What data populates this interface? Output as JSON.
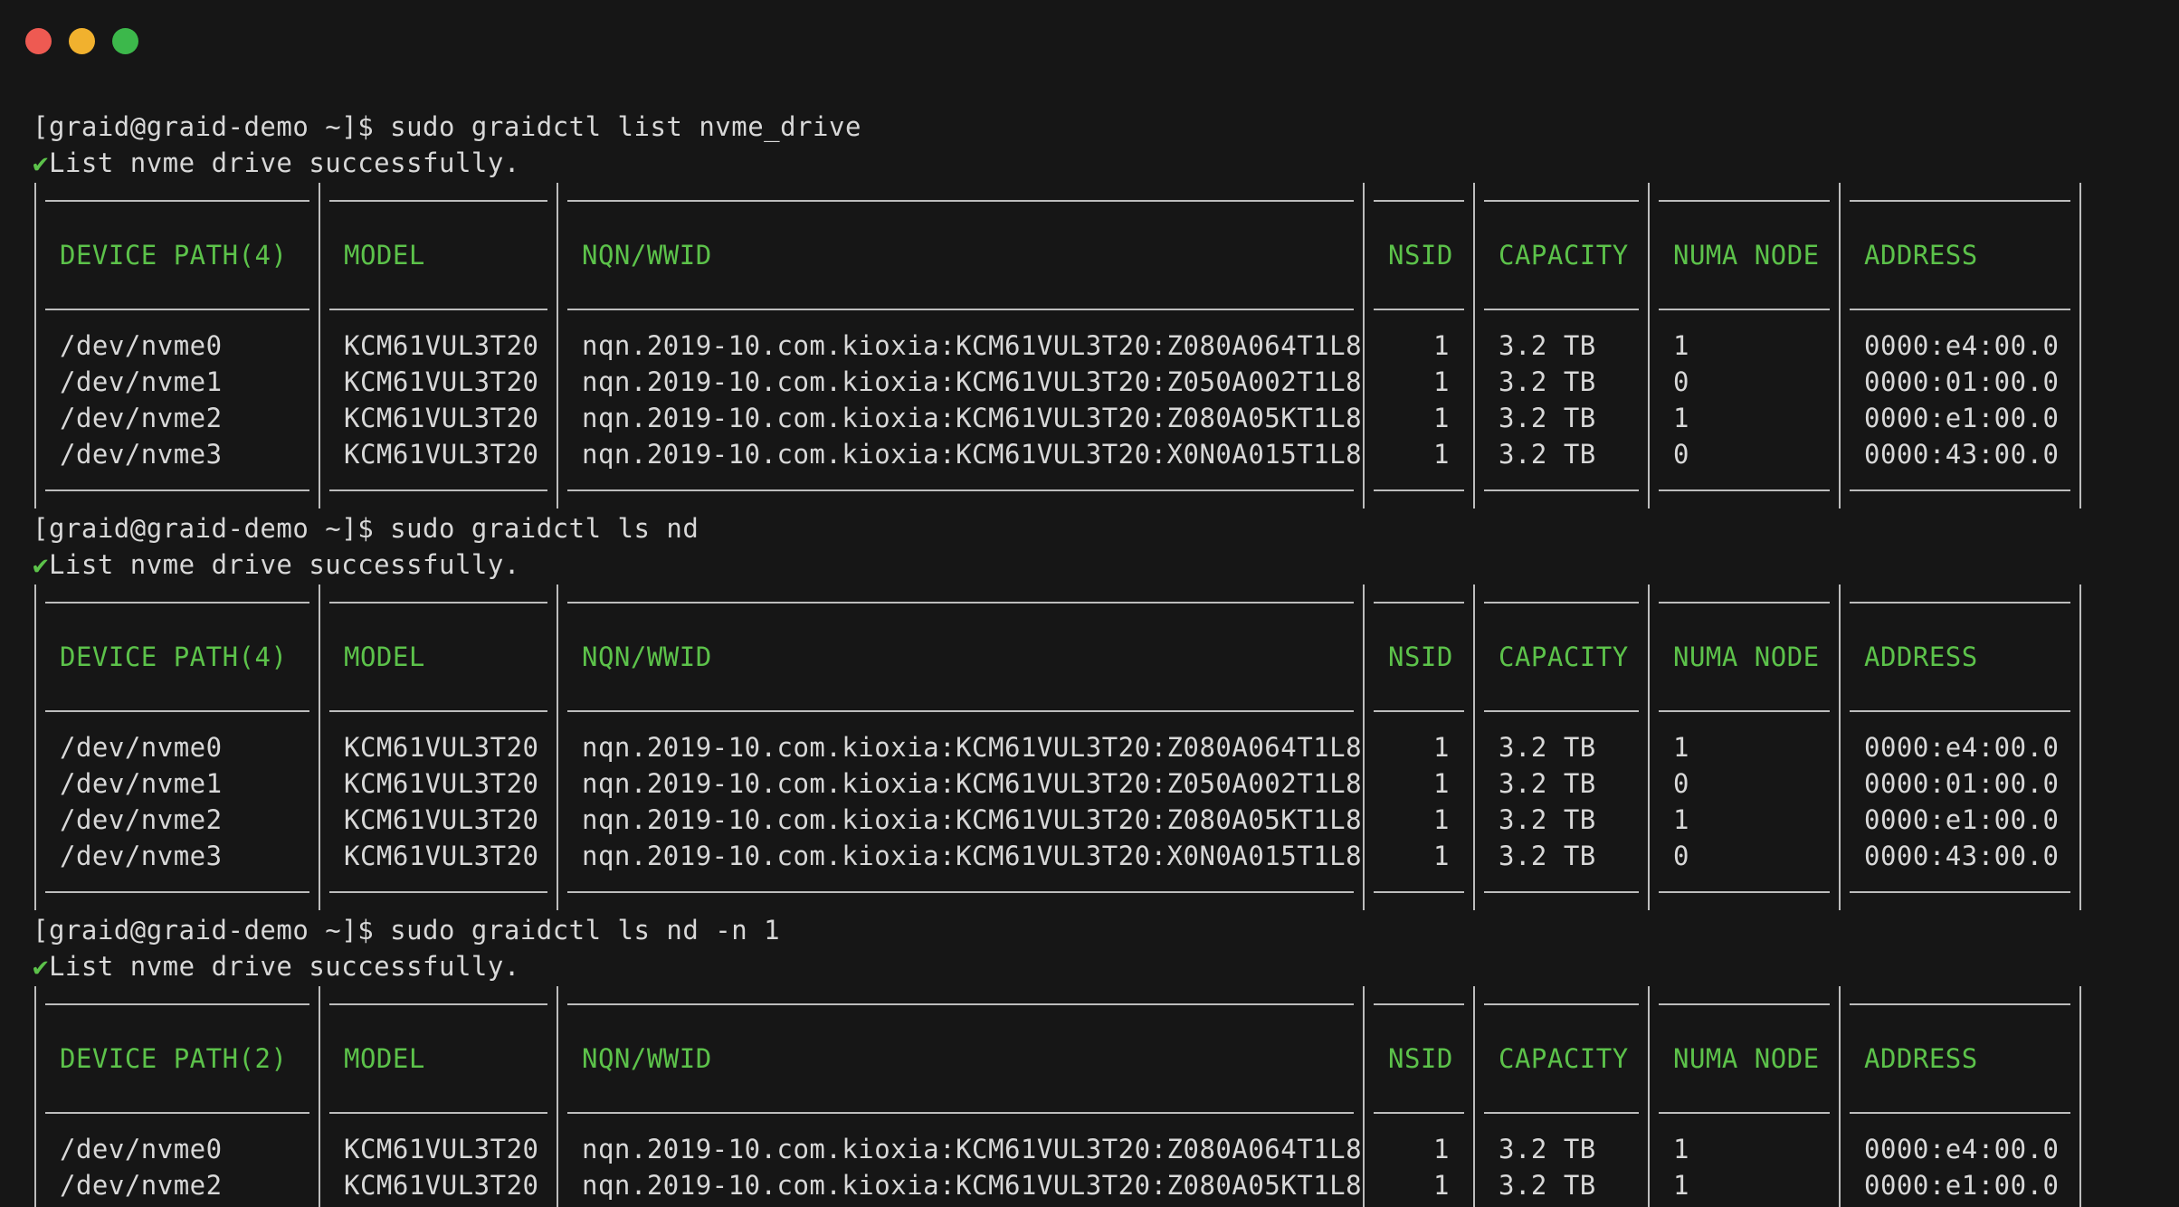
{
  "window": {
    "controls": [
      {
        "name": "close",
        "color": "#ee5a52"
      },
      {
        "name": "minimize",
        "color": "#f1b12e"
      },
      {
        "name": "zoom",
        "color": "#3cb84b"
      }
    ]
  },
  "blocks": [
    {
      "prompt": "[graid@graid-demo ~]$ sudo graidctl list nvme_drive",
      "status": "List nvme drive successfully.",
      "headers": [
        "DEVICE PATH(4)",
        "MODEL",
        "NQN/WWID",
        "NSID",
        "CAPACITY",
        "NUMA NODE",
        "ADDRESS"
      ],
      "rows": [
        [
          "/dev/nvme0",
          "KCM61VUL3T20",
          "nqn.2019-10.com.kioxia:KCM61VUL3T20:Z080A064T1L8",
          "1",
          "3.2 TB",
          "1",
          "0000:e4:00.0"
        ],
        [
          "/dev/nvme1",
          "KCM61VUL3T20",
          "nqn.2019-10.com.kioxia:KCM61VUL3T20:Z050A002T1L8",
          "1",
          "3.2 TB",
          "0",
          "0000:01:00.0"
        ],
        [
          "/dev/nvme2",
          "KCM61VUL3T20",
          "nqn.2019-10.com.kioxia:KCM61VUL3T20:Z080A05KT1L8",
          "1",
          "3.2 TB",
          "1",
          "0000:e1:00.0"
        ],
        [
          "/dev/nvme3",
          "KCM61VUL3T20",
          "nqn.2019-10.com.kioxia:KCM61VUL3T20:X0N0A015T1L8",
          "1",
          "3.2 TB",
          "0",
          "0000:43:00.0"
        ]
      ]
    },
    {
      "prompt": "[graid@graid-demo ~]$ sudo graidctl ls nd",
      "status": "List nvme drive successfully.",
      "headers": [
        "DEVICE PATH(4)",
        "MODEL",
        "NQN/WWID",
        "NSID",
        "CAPACITY",
        "NUMA NODE",
        "ADDRESS"
      ],
      "rows": [
        [
          "/dev/nvme0",
          "KCM61VUL3T20",
          "nqn.2019-10.com.kioxia:KCM61VUL3T20:Z080A064T1L8",
          "1",
          "3.2 TB",
          "1",
          "0000:e4:00.0"
        ],
        [
          "/dev/nvme1",
          "KCM61VUL3T20",
          "nqn.2019-10.com.kioxia:KCM61VUL3T20:Z050A002T1L8",
          "1",
          "3.2 TB",
          "0",
          "0000:01:00.0"
        ],
        [
          "/dev/nvme2",
          "KCM61VUL3T20",
          "nqn.2019-10.com.kioxia:KCM61VUL3T20:Z080A05KT1L8",
          "1",
          "3.2 TB",
          "1",
          "0000:e1:00.0"
        ],
        [
          "/dev/nvme3",
          "KCM61VUL3T20",
          "nqn.2019-10.com.kioxia:KCM61VUL3T20:X0N0A015T1L8",
          "1",
          "3.2 TB",
          "0",
          "0000:43:00.0"
        ]
      ]
    },
    {
      "prompt": "[graid@graid-demo ~]$ sudo graidctl ls nd -n 1",
      "status": "List nvme drive successfully.",
      "headers": [
        "DEVICE PATH(2)",
        "MODEL",
        "NQN/WWID",
        "NSID",
        "CAPACITY",
        "NUMA NODE",
        "ADDRESS"
      ],
      "rows": [
        [
          "/dev/nvme0",
          "KCM61VUL3T20",
          "nqn.2019-10.com.kioxia:KCM61VUL3T20:Z080A064T1L8",
          "1",
          "3.2 TB",
          "1",
          "0000:e4:00.0"
        ],
        [
          "/dev/nvme2",
          "KCM61VUL3T20",
          "nqn.2019-10.com.kioxia:KCM61VUL3T20:Z080A05KT1L8",
          "1",
          "3.2 TB",
          "1",
          "0000:e1:00.0"
        ]
      ]
    }
  ],
  "style": {
    "background": "#161616",
    "text": "#d8d8d8",
    "accent_green": "#5cc24a",
    "border": "#bdbdbd"
  }
}
